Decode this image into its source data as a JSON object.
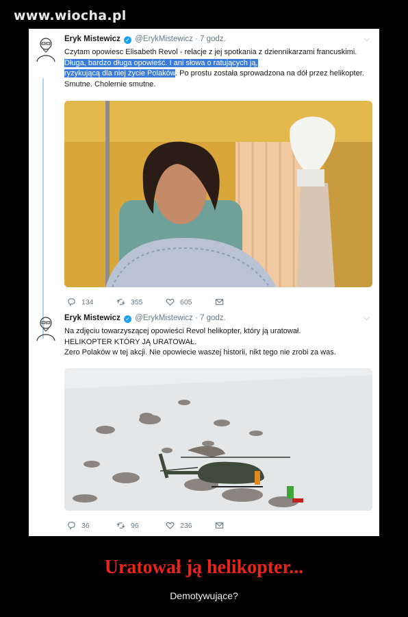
{
  "site": {
    "watermark": "www.wiocha.pl"
  },
  "tweets": [
    {
      "name": "Eryk Mistewicz",
      "handle": "@ErykMistewicz",
      "time": "· 7 godz.",
      "text_before": "Czytam opowiesc Elisabeth Revol - relacje z jej spotkania z dziennikarzami francuskimi.",
      "text_highlight_1": " Długa, bardzo długa opowieść. I ani słowa o ratujących ją,",
      "text_highlight_2": "ryzykującą dla niej życie Polaków",
      "text_after": ". Po prostu została sprowadzona na dół przez helikopter. Smutne. Cholernie smutne.",
      "replies": "134",
      "retweets": "355",
      "likes": "605"
    },
    {
      "name": "Eryk Mistewicz",
      "handle": "@ErykMistewicz",
      "time": "· 7 godz.",
      "line1": "Na zdjęciu towarzyszącej opowieści Revol helikopter, który ją uratował.",
      "line2": "HELIKOPTER KTÓRY JĄ URATOWAŁ.",
      "line3": "Zero Polaków w tej akcji. Nie opowiecie waszej historii, nikt tego nie zrobi za was.",
      "replies": "36",
      "retweets": "96",
      "likes": "236"
    }
  ],
  "caption": {
    "title": "Uratował ją helikopter...",
    "subtitle": "Demotywujące?"
  },
  "colors": {
    "title": "#e8241b",
    "highlight": "#3b7bd9",
    "verified": "#1da1f2"
  }
}
